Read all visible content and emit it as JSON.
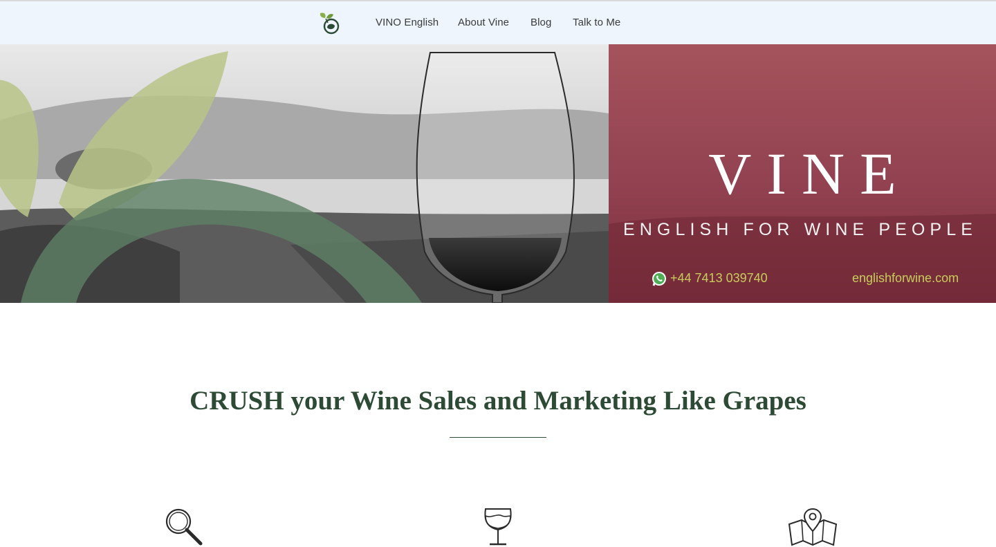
{
  "nav": {
    "logo_icon": "vine-leaf-logo-icon",
    "links": [
      {
        "label": "VINO English"
      },
      {
        "label": "About Vine"
      },
      {
        "label": "Blog"
      },
      {
        "label": "Talk to Me"
      }
    ]
  },
  "hero": {
    "title": "VINE",
    "subtitle": "ENGLISH FOR WINE PEOPLE",
    "phone_icon": "whatsapp-icon",
    "phone": "+44 7413 039740",
    "website": "englishforwine.com"
  },
  "main": {
    "headline": "CRUSH your Wine Sales and Marketing Like Grapes"
  },
  "features": {
    "icons": [
      "magnifying-glass-icon",
      "wine-glass-icon",
      "map-pin-icon"
    ]
  },
  "colors": {
    "nav_background": "#eef5fd",
    "hero_panel": "#9a4450",
    "accent_green": "#2c4a34",
    "leaf_light": "#b8c487",
    "leaf_dark": "#5e7f65",
    "contact_text": "#c8cc5a"
  }
}
